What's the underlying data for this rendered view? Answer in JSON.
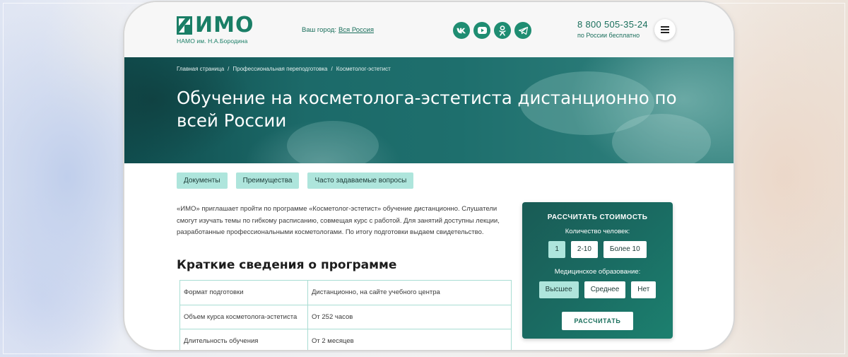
{
  "colors": {
    "brand": "#1a7e66",
    "tab_bg": "#aee5dc",
    "calc_bg": "#1a6b62",
    "table_border": "#a8ddd3"
  },
  "header": {
    "logo_text": "ИМО",
    "logo_subtitle": "НАМО им. Н.А.Бородина",
    "city_label": "Ваш город:",
    "city_value": "Вся Россия",
    "socials": [
      {
        "icon": "vk-icon"
      },
      {
        "icon": "youtube-icon"
      },
      {
        "icon": "odnoklassniki-icon"
      },
      {
        "icon": "telegram-icon"
      }
    ],
    "phone": "8 800 505-35-24",
    "phone_note": "по России бесплатно",
    "menu_icon": "hamburger-icon"
  },
  "hero": {
    "breadcrumbs": [
      "Главная страница",
      "Профессиональная переподготовка",
      "Косметолог-эстетист"
    ],
    "title": "Обучение на косметолога-эстетиста дистанционно по всей России"
  },
  "tabs": [
    "Документы",
    "Преимущества",
    "Часто задаваемые вопросы"
  ],
  "intro": "«ИМО» приглашает пройти по программе «Косметолог-эстетист» обучение дистанционно. Слушатели смогут изучать темы по гибкому расписанию, совмещая курс с работой. Для занятий доступны лекции, разработанные профессиональными косметологами. По итогу подготовки выдаем свидетельство.",
  "summary": {
    "title": "Краткие сведения о программе",
    "rows": [
      {
        "key": "Формат подготовки",
        "value": "Дистанционно, на сайте учебного центра"
      },
      {
        "key": "Объем курса косметолога-эстетиста",
        "value": "От 252 часов"
      },
      {
        "key": "Длительность обучения",
        "value": "От 2 месяцев"
      }
    ]
  },
  "calculator": {
    "title": "РАССЧИТАТЬ СТОИМОСТЬ",
    "people_label": "Количество человек:",
    "people_options": [
      "1",
      "2-10",
      "Более 10"
    ],
    "people_selected": "1",
    "education_label": "Медицинское образование:",
    "education_options": [
      "Высшее",
      "Среднее",
      "Нет"
    ],
    "education_selected": "Высшее",
    "submit_label": "РАССЧИТАТЬ"
  }
}
